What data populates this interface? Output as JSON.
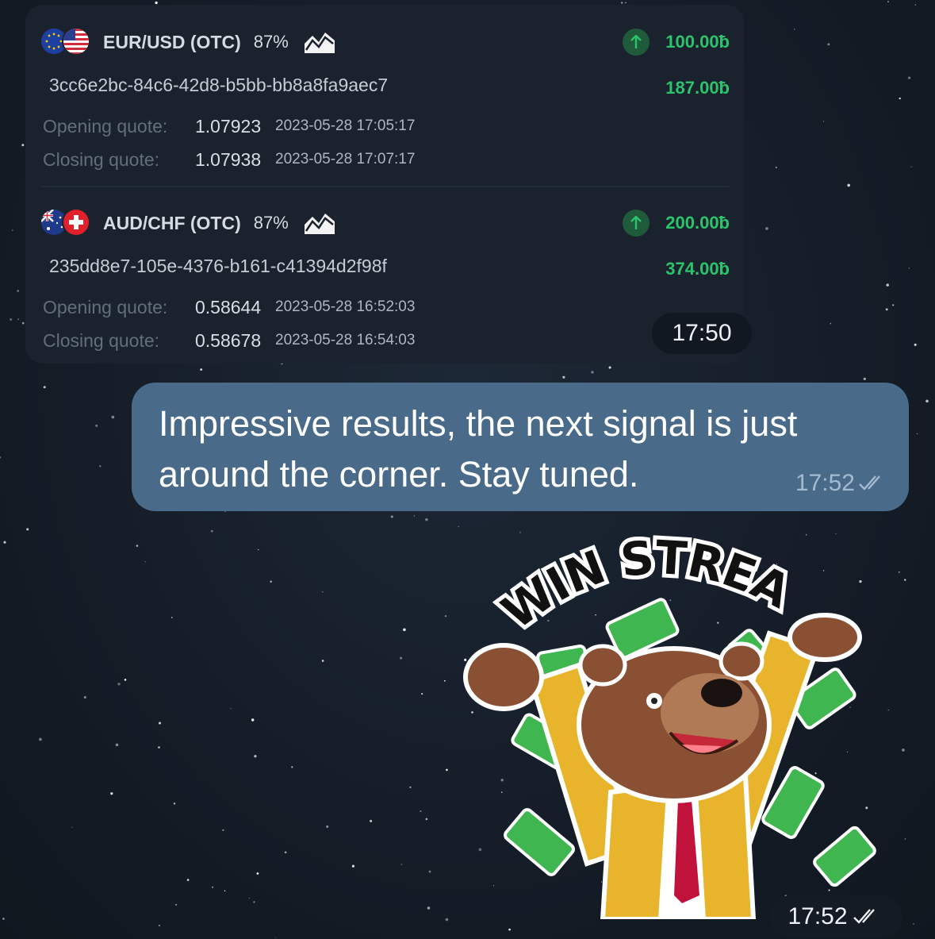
{
  "trades": [
    {
      "pair": "EUR/USD (OTC)",
      "percent": "87%",
      "amount": "100.00ƀ",
      "payout": "187.00ƀ",
      "id": "3cc6e2bc-84c6-42d8-b5bb-bb8a8fa9aec7",
      "opening_label": "Opening quote:",
      "opening_value": "1.07923",
      "opening_time": "2023-05-28 17:05:17",
      "closing_label": "Closing quote:",
      "closing_value": "1.07938",
      "closing_time": "2023-05-28 17:07:17",
      "flag_icons": [
        "eu-flag-icon",
        "us-flag-icon"
      ],
      "direction_icon": "arrow-up-icon"
    },
    {
      "pair": "AUD/CHF (OTC)",
      "percent": "87%",
      "amount": "200.00ƀ",
      "payout": "374.00ƀ",
      "id": "235dd8e7-105e-4376-b161-c41394d2f98f",
      "opening_label": "Opening quote:",
      "opening_value": "0.58644",
      "opening_time": "2023-05-28 16:52:03",
      "closing_label": "Closing quote:",
      "closing_value": "0.58678",
      "closing_time": "2023-05-28 16:54:03",
      "flag_icons": [
        "au-flag-icon",
        "ch-flag-icon"
      ],
      "direction_icon": "arrow-up-icon"
    }
  ],
  "trade_card_time": "17:50",
  "message": {
    "text": "Impressive results, the next signal is just around the corner. Stay tuned.",
    "time": "17:52",
    "status_icon": "double-check-icon"
  },
  "sticker": {
    "caption": "WIN STREAK",
    "time": "17:52",
    "status_icon": "double-check-icon"
  },
  "colors": {
    "profit_green": "#2bc46c",
    "bubble_blue": "#4a6a8a",
    "card_bg": "#1a222e"
  }
}
